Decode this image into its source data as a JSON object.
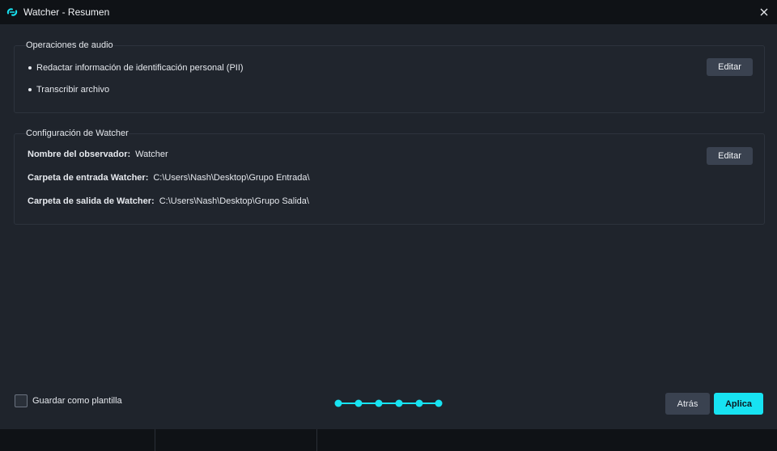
{
  "window": {
    "title": "Watcher - Resumen",
    "accent": "#17e3f2"
  },
  "audio_ops": {
    "title": "Operaciones de audio",
    "items": [
      "Redactar información de identificación personal (PII)",
      "Transcribir archivo"
    ],
    "edit_label": "Editar"
  },
  "watcher_config": {
    "title": "Configuración de Watcher",
    "rows": [
      {
        "key": "Nombre del observador:",
        "value": "Watcher"
      },
      {
        "key": "Carpeta de entrada Watcher:",
        "value": "C:\\Users\\Nash\\Desktop\\Grupo Entrada\\"
      },
      {
        "key": "Carpeta de salida de Watcher:",
        "value": "C:\\Users\\Nash\\Desktop\\Grupo Salida\\"
      }
    ],
    "edit_label": "Editar"
  },
  "footer": {
    "save_template_label": "Guardar como plantilla",
    "save_template_checked": false,
    "steps_total": 6,
    "steps_completed": 6,
    "back_label": "Atrás",
    "apply_label": "Aplica"
  }
}
